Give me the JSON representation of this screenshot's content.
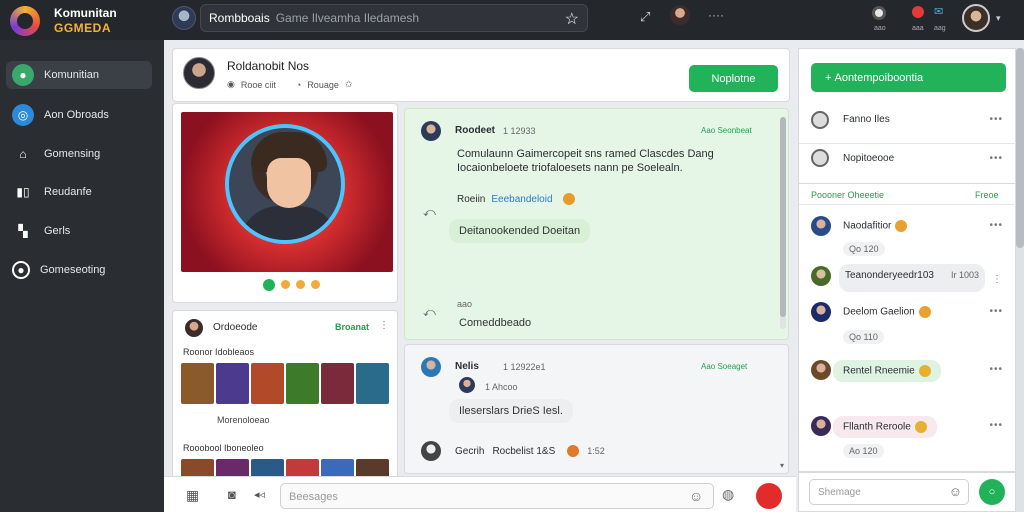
{
  "topbar": {
    "brand_line1": "Komunitan",
    "brand_line2": "GGMEDA",
    "search_bold": "Rombboais",
    "search_rest": "Game Ilveamha Iledamesh",
    "dots": "····",
    "label1": "aao",
    "label2": "aaa",
    "label3": "aag"
  },
  "sidebar": {
    "items": [
      {
        "label": "Komunitian",
        "color": "#3aa86b"
      },
      {
        "label": "Aon Obroads",
        "color": "#2c8ad8"
      },
      {
        "label": "Gomensing",
        "color": ""
      },
      {
        "label": "Reudanfe",
        "color": ""
      },
      {
        "label": "Gerls",
        "color": ""
      },
      {
        "label": "Gomeseoting",
        "color": ""
      }
    ]
  },
  "profile": {
    "name": "Roldanobit Nos",
    "meta1": "Rooe ciit",
    "meta2": "Rouage",
    "button": "Noplotne"
  },
  "gallery": {
    "user": "Ordoeode",
    "tag": "Broanat",
    "section1": "Roonor Idobleaos",
    "caption": "Morenoloeao",
    "section2": "Rooobool Iboneoleo",
    "thumbs1": [
      "#8a5a2a",
      "#4c3a8e",
      "#b24a2a",
      "#3d7a2a",
      "#7a2a3a",
      "#2a6a8a"
    ],
    "thumbs2": [
      "#8a4a2a",
      "#6a2a6a",
      "#2a5a8a",
      "#c23a3a",
      "#3a6aba",
      "#5a3a2a"
    ]
  },
  "chat": {
    "msg1_name": "Roodeet",
    "msg1_time": "1 12933",
    "msg1_tag": "Aao Seonbeat",
    "msg1_text": "Comulaunn Gaimercopeit sns ramed Clascdes Dang Iocaionbeloete triofaloesets nann pe Soelealn.",
    "msg2_name": "Roeiin",
    "msg2_link": "Eeebandeloid",
    "msg2_text": "Deitanookended Doeitan",
    "msg3_name": "aao",
    "msg3_text": "Comeddbeado",
    "msg4_name": "Nelis",
    "msg4_time": "1 12922e1",
    "msg4_tag": "Aao Soeaget",
    "msg4_sub": "1 Ahcoo",
    "msg4_text": "Ileserslars DrieS Iesl.",
    "msg5_name": "Gecrih",
    "msg5_name2": "Rocbelist 1&S",
    "msg5_time": "1:52"
  },
  "composer": {
    "placeholder": "Beesages"
  },
  "right": {
    "button": "Aontempoiboontia",
    "item1": "Fanno Iles",
    "item2": "Nopitoeooe",
    "section": "Poooner Oheeetie",
    "section_link": "Freoe",
    "users": [
      {
        "name": "Naodafitior",
        "sub": "Qo 120"
      },
      {
        "name": "Teanonderyeedr103",
        "sub": "Ir 1003"
      },
      {
        "name": "Deelom Gaelion",
        "sub": "Qo 110"
      },
      {
        "name": "Rentel Rneemie",
        "sub": ""
      },
      {
        "name": "Fllanth Reroole",
        "sub": "Ao 120"
      }
    ],
    "composer_placeholder": "Shemage"
  }
}
